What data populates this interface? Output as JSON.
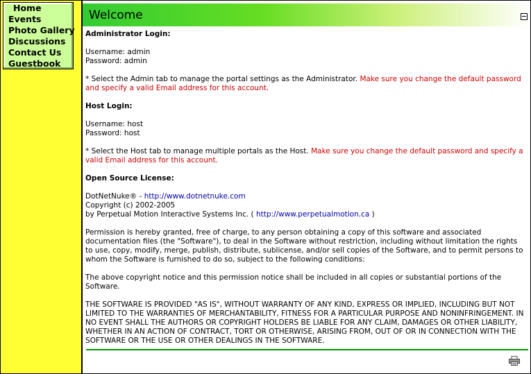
{
  "menu": {
    "items": [
      "Home",
      "Events",
      "Photo Gallery",
      "Discussions",
      "Contact Us",
      "Guestbook"
    ]
  },
  "module": {
    "title": "Welcome",
    "minimize_icon": "minimize-icon",
    "print_icon": "printer-icon"
  },
  "admin": {
    "heading": "Administrator Login:",
    "username": "Username: admin",
    "password": "Password: admin",
    "note_prefix": "* Select the Admin tab to manage the portal settings as the Administrator. ",
    "note_warning": "Make sure you change the default password and specify a valid Email address for this account."
  },
  "host": {
    "heading": "Host Login:",
    "username": "Username: host",
    "password": "Password: host",
    "note_prefix": "* Select the Host tab to manage multiple portals as the Host. ",
    "note_warning": "Make sure you change the default password and specify a valid Email address for this account."
  },
  "license": {
    "heading": "Open Source License:",
    "product": "DotNetNuke® - ",
    "product_url": "http://www.dotnetnuke.com",
    "copyright": "Copyright (c) 2002-2005",
    "by_prefix": "by Perpetual Motion Interactive Systems Inc. ( ",
    "by_url": "http://www.perpetualmotion.ca",
    "by_suffix": " )",
    "permission": "Permission is hereby granted, free of charge, to any person obtaining a copy of this software and associated documentation files (the \"Software\"), to deal in the Software without restriction, including without limitation the rights to use, copy, modify, merge, publish, distribute, sublicense, and/or sell copies of the Software, and to permit persons to whom the Software is furnished to do so, subject to the following conditions:",
    "notice": "The above copyright notice and this permission notice shall be included in all copies or substantial portions of the Software.",
    "warranty": "THE SOFTWARE IS PROVIDED \"AS IS\", WITHOUT WARRANTY OF ANY KIND, EXPRESS OR IMPLIED, INCLUDING BUT NOT LIMITED TO THE WARRANTIES OF MERCHANTABILITY, FITNESS FOR A PARTICULAR PURPOSE AND NONINFRINGEMENT. IN NO EVENT SHALL THE AUTHORS OR COPYRIGHT HOLDERS BE LIABLE FOR ANY CLAIM, DAMAGES OR OTHER LIABILITY, WHETHER IN AN ACTION OF CONTRACT, TORT OR OTHERWISE, ARISING FROM, OUT OF OR IN CONNECTION WITH THE SOFTWARE OR THE USE OR OTHER DEALINGS IN THE SOFTWARE."
  },
  "colors": {
    "sidebar": "#ffff33",
    "menu": "#ccff99",
    "title_gradient_start": "#33cc33",
    "warning_text": "#cc0000",
    "link": "#0000aa",
    "rule": "#009900"
  }
}
